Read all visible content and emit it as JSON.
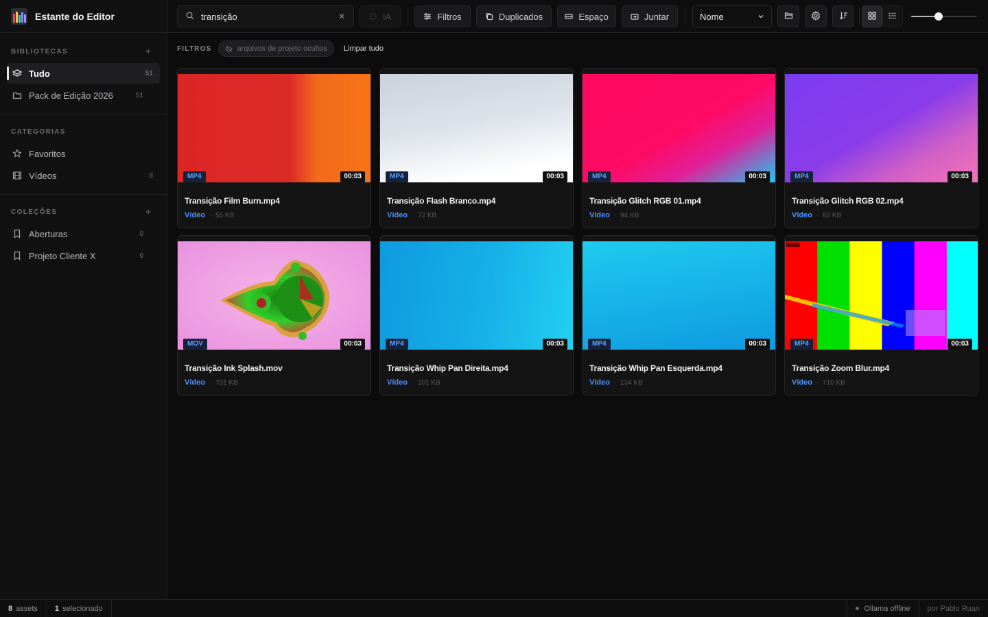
{
  "app": {
    "title": "Estante do Editor"
  },
  "sidebar": {
    "libraries": {
      "title": "BIBLIOTECAS",
      "items": [
        {
          "label": "Tudo",
          "count": "51",
          "active": true
        },
        {
          "label": "Pack de Edição 2026",
          "count": "51"
        }
      ]
    },
    "categories": {
      "title": "CATEGORIAS",
      "items": [
        {
          "label": "Favoritos",
          "count": ""
        },
        {
          "label": "Vídeos",
          "count": "8"
        }
      ]
    },
    "collections": {
      "title": "COLEÇÕES",
      "items": [
        {
          "label": "Aberturas",
          "count": "0"
        },
        {
          "label": "Projeto Cliente X",
          "count": "0"
        }
      ]
    }
  },
  "toolbar": {
    "search_value": "transição",
    "ai_label": "IA",
    "filters_label": "Filtros",
    "duplicates_label": "Duplicados",
    "space_label": "Espaço",
    "merge_label": "Juntar",
    "sort_value": "Nome",
    "zoom_level": 0.42
  },
  "filterbar": {
    "label": "FILTROS",
    "chip": "arquivos de projeto ocultos",
    "clear_all": "Limpar tudo"
  },
  "assets": [
    {
      "name": "Transição Film Burn.mp4",
      "type": "MP4",
      "duration": "00:03",
      "kind": "Vídeo",
      "size": "55 KB",
      "thumb": "linear-gradient(90deg, #dc2626 0%, #dc2a26 58%, #f26a1c 72%, #f97316 100%)"
    },
    {
      "name": "Transição Flash Branco.mp4",
      "type": "MP4",
      "duration": "00:03",
      "kind": "Vídeo",
      "size": "72 KB",
      "thumb": "linear-gradient(170deg, #cbd2dc 0%, #dde2ea 45%, #ffffff 85%, #ffffff 100%)"
    },
    {
      "name": "Transição Glitch RGB 01.mp4",
      "type": "MP4",
      "duration": "00:03",
      "kind": "Vídeo",
      "size": "94 KB",
      "thumb": "linear-gradient(150deg, #ff0a5e 0%, #ff0a64 52%, #e0209a 72%, #1ec8f0 100%)"
    },
    {
      "name": "Transição Glitch RGB 02.mp4",
      "type": "MP4",
      "duration": "00:03",
      "kind": "Vídeo",
      "size": "62 KB",
      "thumb": "linear-gradient(150deg, #7b3cf0 0%, #8a3cea 50%, #d060c6 75%, #f472b6 100%)"
    },
    {
      "name": "Transição Ink Splash.mov",
      "type": "MOV",
      "duration": "00:03",
      "kind": "Vídeo",
      "size": "701 KB",
      "thumb": "fractal"
    },
    {
      "name": "Transição Whip Pan Direita.mp4",
      "type": "MP4",
      "duration": "00:03",
      "kind": "Vídeo",
      "size": "101 KB",
      "thumb": "linear-gradient(100deg, #0f9ae0 0%, #16b0e8 55%, #22d0f0 100%)"
    },
    {
      "name": "Transição Whip Pan Esquerda.mp4",
      "type": "MP4",
      "duration": "00:03",
      "kind": "Vídeo",
      "size": "134 KB",
      "thumb": "linear-gradient(170deg, #1ecbee 0%, #16b2e8 50%, #0f9ae0 100%)"
    },
    {
      "name": "Transição Zoom Blur.mp4",
      "type": "MP4",
      "duration": "00:03",
      "kind": "Vídeo",
      "size": "710 KB",
      "thumb": "bars"
    }
  ],
  "status": {
    "assets_count": "8",
    "assets_label": "assets",
    "selected_count": "1",
    "selected_label": "selecionado",
    "ollama": "Ollama offline",
    "credit": "por Pablo Ruan"
  }
}
